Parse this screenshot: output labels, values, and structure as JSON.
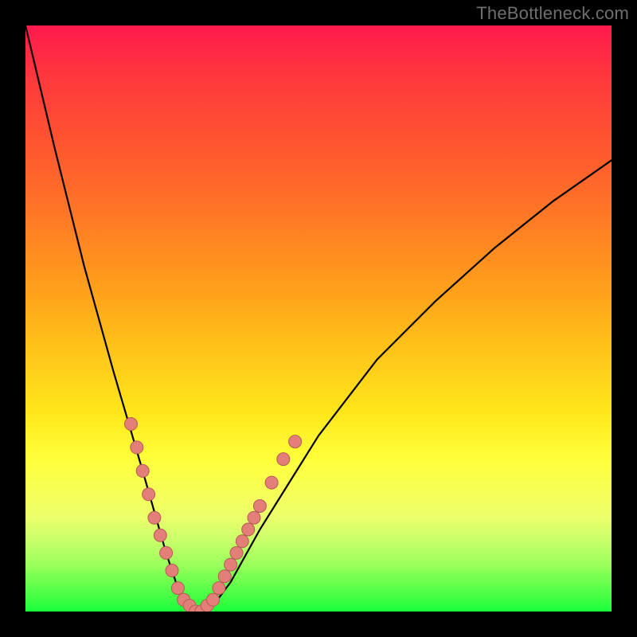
{
  "watermark": "TheBottleneck.com",
  "colors": {
    "frame": "#000000",
    "gradient_top": "#ff1a4d",
    "gradient_bottom": "#1aff3a",
    "curve": "#000000",
    "marker_fill": "#e37f78",
    "marker_stroke": "#b55a55"
  },
  "chart_data": {
    "type": "line",
    "title": "",
    "xlabel": "",
    "ylabel": "",
    "xlim": [
      0,
      100
    ],
    "ylim": [
      0,
      100
    ],
    "grid": false,
    "legend": false,
    "series": [
      {
        "name": "bottleneck-curve",
        "x": [
          0,
          5,
          10,
          15,
          20,
          22,
          24,
          26,
          28,
          30,
          32,
          35,
          40,
          50,
          60,
          70,
          80,
          90,
          100
        ],
        "y": [
          100,
          79,
          59,
          41,
          24,
          17,
          10,
          4,
          1,
          0,
          1,
          5,
          14,
          30,
          43,
          53,
          62,
          70,
          77
        ]
      }
    ],
    "markers": {
      "name": "highlighted-region",
      "points": [
        {
          "x": 18,
          "y": 32
        },
        {
          "x": 19,
          "y": 28
        },
        {
          "x": 20,
          "y": 24
        },
        {
          "x": 21,
          "y": 20
        },
        {
          "x": 22,
          "y": 16
        },
        {
          "x": 23,
          "y": 13
        },
        {
          "x": 24,
          "y": 10
        },
        {
          "x": 25,
          "y": 7
        },
        {
          "x": 26,
          "y": 4
        },
        {
          "x": 27,
          "y": 2
        },
        {
          "x": 28,
          "y": 1
        },
        {
          "x": 29,
          "y": 0
        },
        {
          "x": 30,
          "y": 0
        },
        {
          "x": 31,
          "y": 1
        },
        {
          "x": 32,
          "y": 2
        },
        {
          "x": 33,
          "y": 4
        },
        {
          "x": 34,
          "y": 6
        },
        {
          "x": 35,
          "y": 8
        },
        {
          "x": 36,
          "y": 10
        },
        {
          "x": 37,
          "y": 12
        },
        {
          "x": 38,
          "y": 14
        },
        {
          "x": 39,
          "y": 16
        },
        {
          "x": 40,
          "y": 18
        },
        {
          "x": 42,
          "y": 22
        },
        {
          "x": 44,
          "y": 26
        },
        {
          "x": 46,
          "y": 29
        }
      ]
    }
  }
}
